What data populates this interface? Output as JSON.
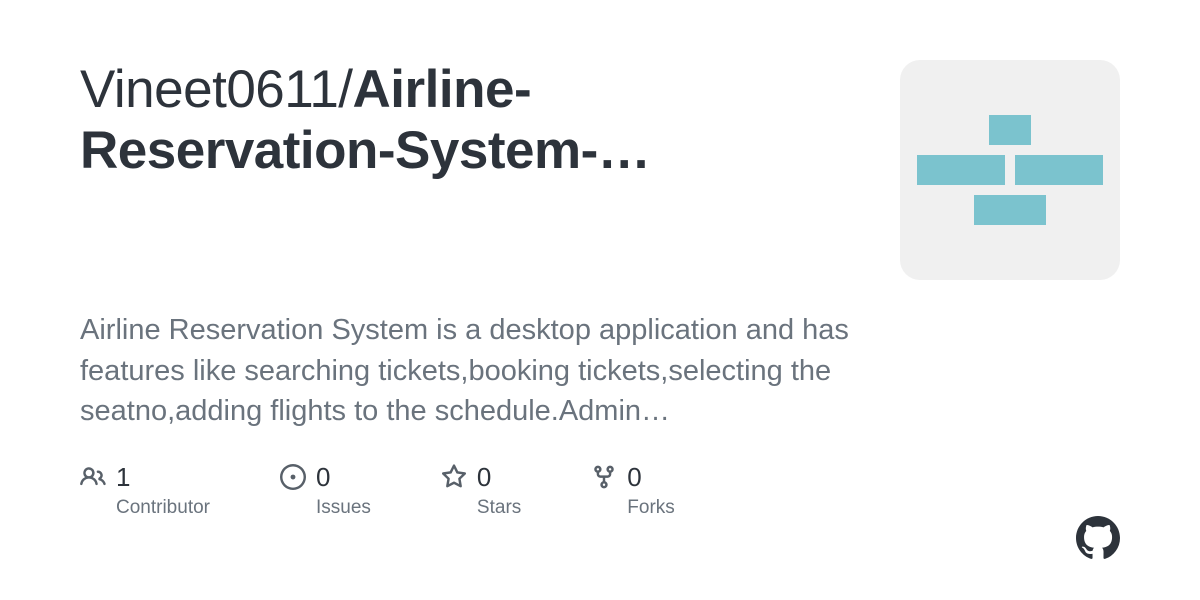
{
  "repo": {
    "owner": "Vineet0611",
    "separator": "/",
    "name_part1": "Airline",
    "name_rest": "-Reservation-System-…"
  },
  "description": "Airline Reservation System is a desktop application and has features like searching tickets,booking tickets,selecting the seatno,adding flights to the schedule.Admin…",
  "stats": {
    "contributors": {
      "value": "1",
      "label": "Contributor"
    },
    "issues": {
      "value": "0",
      "label": "Issues"
    },
    "stars": {
      "value": "0",
      "label": "Stars"
    },
    "forks": {
      "value": "0",
      "label": "Forks"
    }
  }
}
